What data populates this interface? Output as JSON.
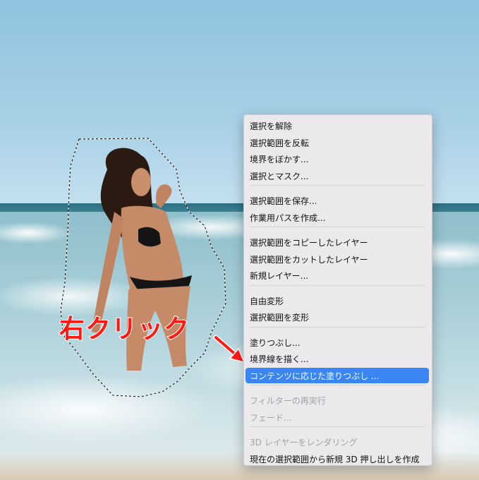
{
  "annotation": {
    "text": "右クリック",
    "color": "#ff1a14"
  },
  "context_menu": {
    "highlight_color": "#3a86f5",
    "groups": [
      {
        "items": [
          {
            "label": "選択を解除",
            "enabled": true
          },
          {
            "label": "選択範囲を反転",
            "enabled": true
          },
          {
            "label": "境界をぼかす...",
            "enabled": true
          },
          {
            "label": "選択とマスク...",
            "enabled": true
          }
        ]
      },
      {
        "items": [
          {
            "label": "選択範囲を保存...",
            "enabled": true
          },
          {
            "label": "作業用パスを作成...",
            "enabled": true
          }
        ]
      },
      {
        "items": [
          {
            "label": "選択範囲をコピーしたレイヤー",
            "enabled": true
          },
          {
            "label": "選択範囲をカットしたレイヤー",
            "enabled": true
          },
          {
            "label": "新規レイヤー...",
            "enabled": true
          }
        ]
      },
      {
        "items": [
          {
            "label": "自由変形",
            "enabled": true
          },
          {
            "label": "選択範囲を変形",
            "enabled": true
          }
        ]
      },
      {
        "items": [
          {
            "label": "塗りつぶし...",
            "enabled": true
          },
          {
            "label": "境界線を描く...",
            "enabled": true
          },
          {
            "label": "コンテンツに応じた塗りつぶし ...",
            "enabled": true,
            "highlighted": true
          }
        ]
      },
      {
        "items": [
          {
            "label": "フィルターの再実行",
            "enabled": false
          },
          {
            "label": "フェード...",
            "enabled": false
          }
        ]
      },
      {
        "items": [
          {
            "label": "3D レイヤーをレンダリング",
            "enabled": false
          },
          {
            "label": "現在の選択範囲から新規 3D 押し出しを作成",
            "enabled": true
          }
        ]
      }
    ]
  }
}
